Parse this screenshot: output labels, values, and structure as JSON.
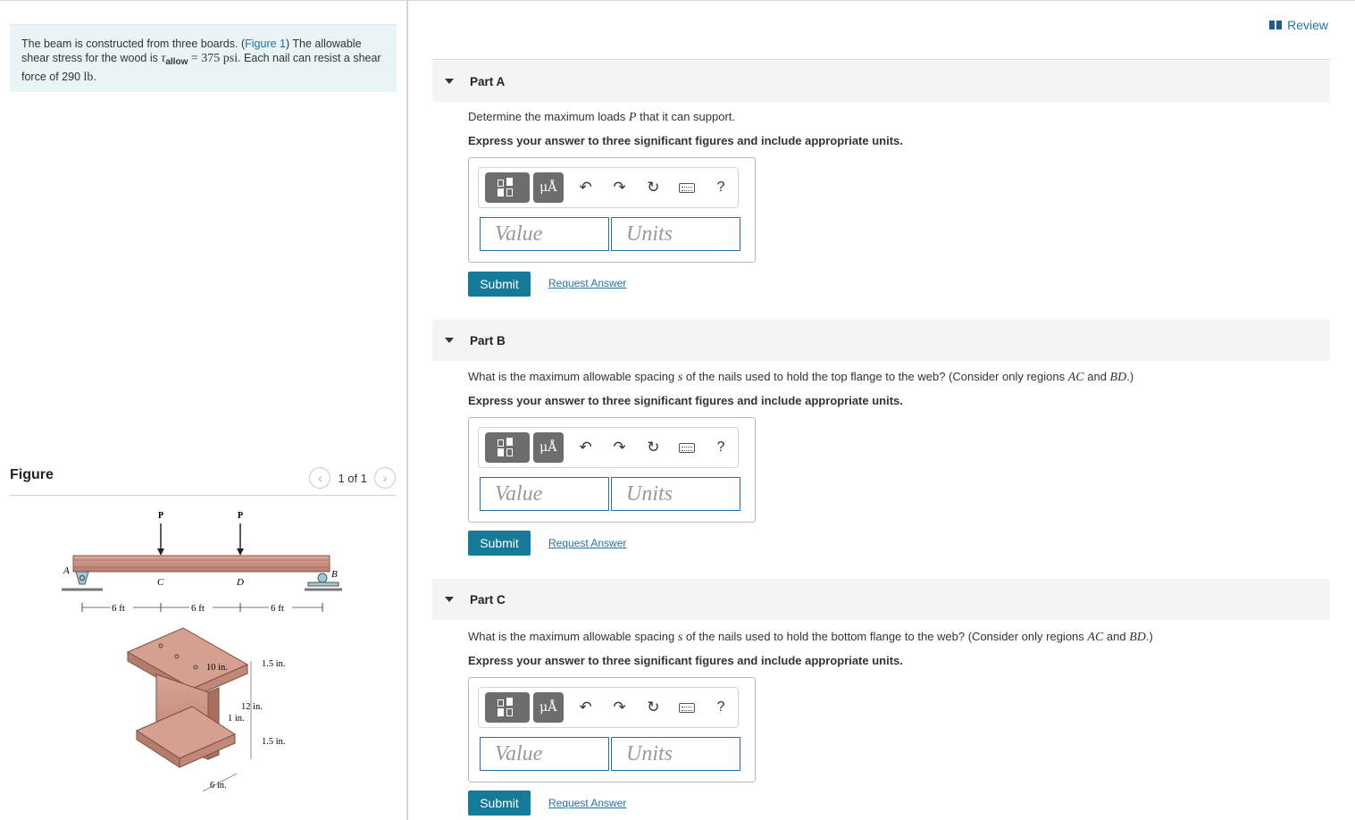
{
  "problem": {
    "text_before_link": "The beam is constructed from three boards. (",
    "figure_link": "Figure 1",
    "text_after_link": ") The allowable shear stress for the wood is ",
    "tau_symbol": "τ",
    "tau_sub": "allow",
    "tau_value": " = 375 psi",
    "text_mid": ". Each nail can resist a shear force of 290 ",
    "force_unit": "lb",
    "text_end": "."
  },
  "figure": {
    "title": "Figure",
    "pager": "1 of 1",
    "prev_icon": "chevron-left-icon",
    "next_icon": "chevron-right-icon",
    "labels": {
      "P1": "P",
      "P2": "P",
      "A": "A",
      "B": "B",
      "C": "C",
      "D": "D",
      "dim1": "6 ft",
      "dim2": "6 ft",
      "dim3": "6 ft",
      "w10": "10 in.",
      "t15top": "1.5 in.",
      "h12": "12 in.",
      "w1": "1 in.",
      "t15bot": "1.5 in.",
      "w6": "6 in."
    }
  },
  "review": {
    "label": "Review",
    "icon": "book-icon"
  },
  "parts": [
    {
      "title": "Part A",
      "question_text": "Determine the maximum loads ",
      "question_var": "P",
      "question_tail": " that it can support.",
      "instruction": "Express your answer to three significant figures and include appropriate units.",
      "value_placeholder": "Value",
      "units_placeholder": "Units",
      "submit": "Submit",
      "request": "Request Answer"
    },
    {
      "title": "Part B",
      "question_text": "What is the maximum allowable spacing ",
      "question_var": "s",
      "question_mid": " of the nails used to hold the top flange to the web? (Consider only regions ",
      "region1": "AC",
      "and": " and ",
      "region2": "BD",
      "question_tail": ".)",
      "instruction": "Express your answer to three significant figures and include appropriate units.",
      "value_placeholder": "Value",
      "units_placeholder": "Units",
      "submit": "Submit",
      "request": "Request Answer"
    },
    {
      "title": "Part C",
      "question_text": "What is the maximum allowable spacing ",
      "question_var": "s",
      "question_mid": " of the nails used to hold the bottom flange to the web? (Consider only regions ",
      "region1": "AC",
      "and": " and ",
      "region2": "BD",
      "question_tail": ".)",
      "instruction": "Express your answer to three significant figures and include appropriate units.",
      "value_placeholder": "Value",
      "units_placeholder": "Units",
      "submit": "Submit",
      "request": "Request Answer"
    }
  ],
  "toolbar": {
    "units_label": "μÅ",
    "undo_icon": "undo-icon",
    "redo_icon": "redo-icon",
    "reset_icon": "reset-icon",
    "keyboard_icon": "keyboard-icon",
    "help_label": "?"
  }
}
